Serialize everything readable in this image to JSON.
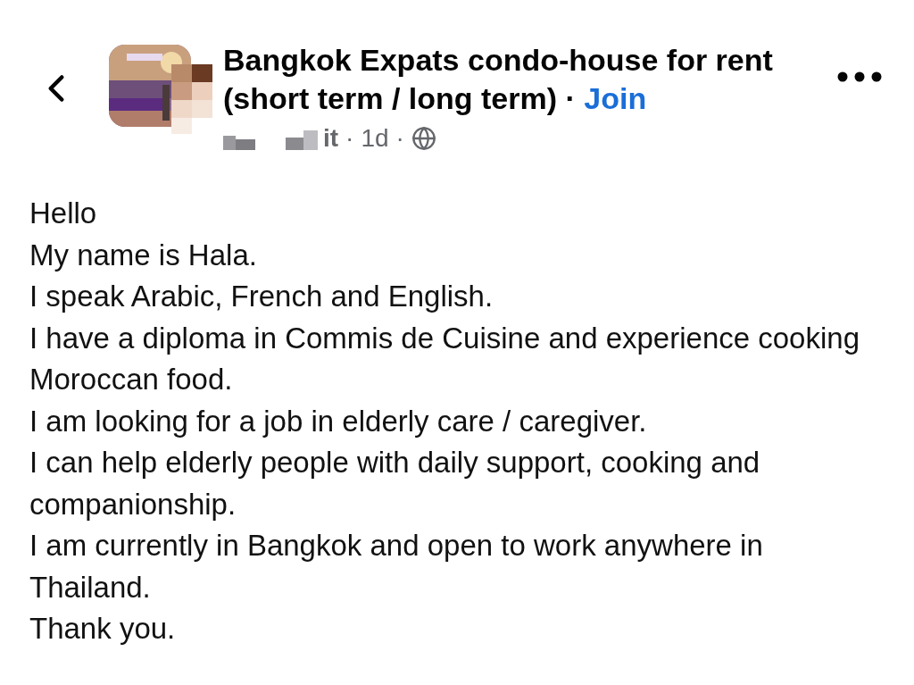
{
  "group": {
    "title": "Bangkok Expats condo-house for rent (short term / long term)",
    "separator": "·",
    "join": "Join"
  },
  "meta": {
    "author": "it",
    "separator": "·",
    "time": "1d",
    "separator_2": "·"
  },
  "body": [
    "Hello",
    "My name is Hala.",
    "I speak Arabic, French and English.",
    "I have a diploma in Commis de Cuisine and experience cooking Moroccan food.",
    "I am looking for a job in elderly care / caregiver.",
    "I can help elderly people with daily support, cooking and companionship.",
    "I am currently in Bangkok and open to work anywhere in Thailand.",
    "Thank you."
  ]
}
